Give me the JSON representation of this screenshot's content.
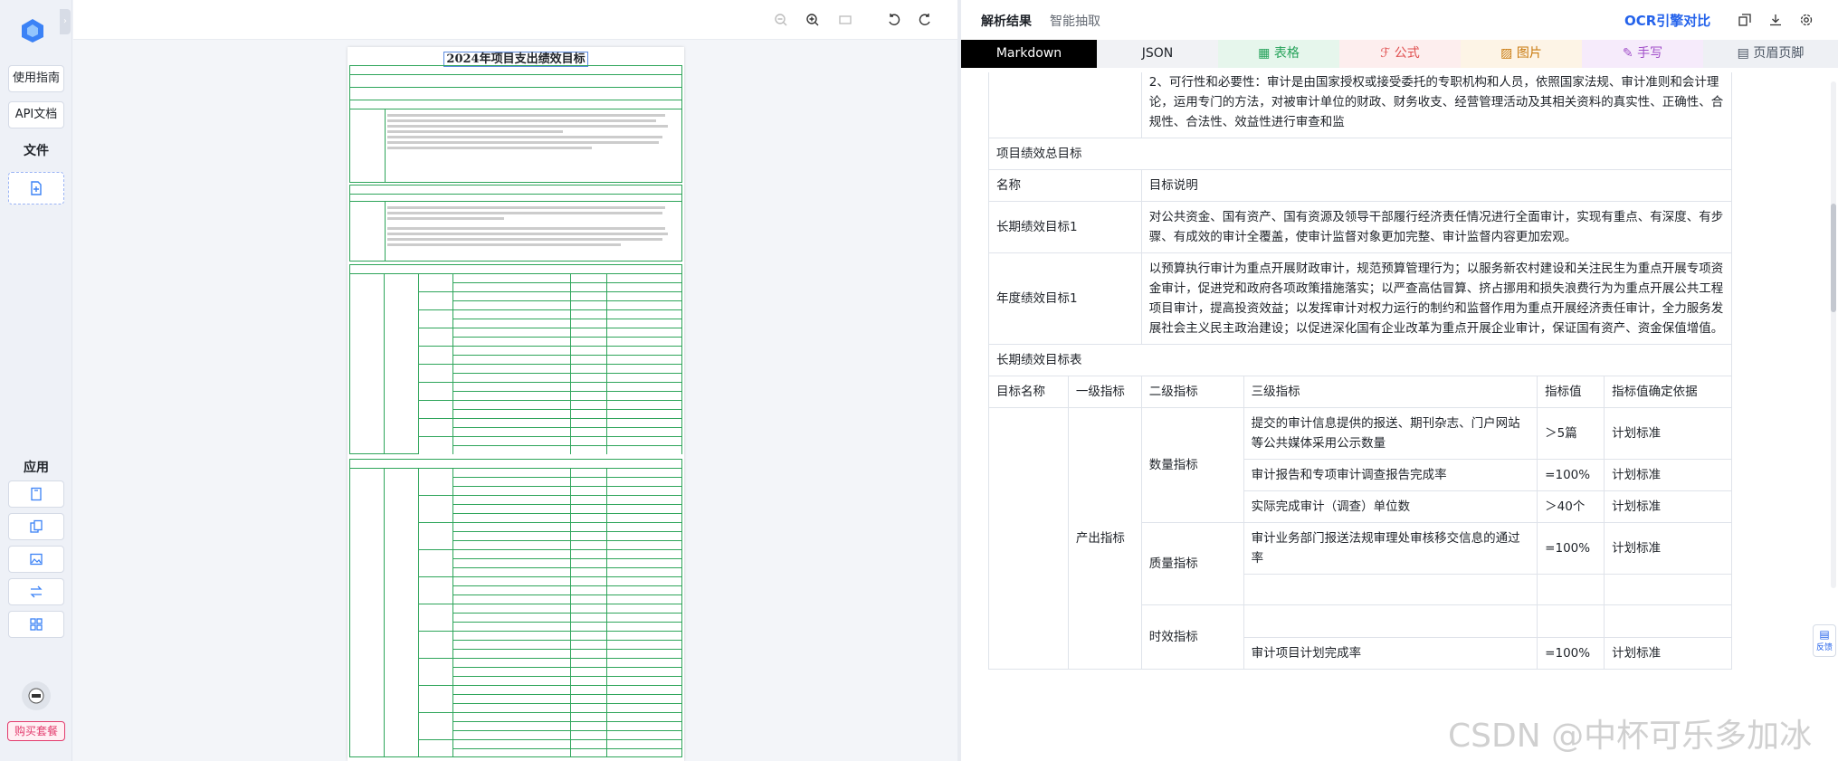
{
  "sidebar": {
    "guide_label": "使用指南",
    "api_label": "API文档",
    "files_title": "文件",
    "apps_title": "应用",
    "buy_label": "购买套餐"
  },
  "document": {
    "title": "2024年项目支出绩效目标"
  },
  "panel": {
    "tab_parse": "解析结果",
    "tab_extract": "智能抽取",
    "ocr_compare": "OCR引擎对比",
    "format_tabs": [
      {
        "label": "Markdown",
        "icon": ""
      },
      {
        "label": "JSON",
        "icon": ""
      },
      {
        "label": "表格",
        "icon": "table-icon"
      },
      {
        "label": "公式",
        "icon": "formula-icon"
      },
      {
        "label": "图片",
        "icon": "image-icon"
      },
      {
        "label": "手写",
        "icon": "handwriting-icon"
      },
      {
        "label": "页眉页脚",
        "icon": "header-footer-icon"
      }
    ],
    "feedback_label": "反馈"
  },
  "result": {
    "necessity_text": "2、可行性和必要性：审计是由国家授权或接受委托的专职机构和人员，依照国家法规、审计准则和会计理论，运用专门的方法，对被审计单位的财政、财务收支、经营管理活动及其相关资料的真实性、正确性、合规性、合法性、效益性进行审查和监",
    "overall_goal": "项目绩效总目标",
    "name_header": "名称",
    "desc_header": "目标说明",
    "long_goal_label": "长期绩效目标1",
    "long_goal_text": "对公共资金、国有资产、国有资源及领导干部履行经济责任情况进行全面审计，实现有重点、有深度、有步骤、有成效的审计全覆盖，使审计监督对象更加完整、审计监督内容更加宏观。",
    "year_goal_label": "年度绩效目标1",
    "year_goal_text": "以预算执行审计为重点开展财政审计，规范预算管理行为；以服务新农村建设和关注民生为重点开展专项资金审计，促进党和政府各项政策措施落实；以严查高估冒算、挤占挪用和损失浪费行为为重点开展公共工程项目审计，提高投资效益；以发挥审计对权力运行的制约和监督作用为重点开展经济责任审计，全力服务发展社会主义民主政治建设；以促进深化国有企业改革为重点开展企业审计，保证国有资产、资金保值增值。",
    "long_table_title": "长期绩效目标表",
    "columns": [
      "目标名称",
      "一级指标",
      "二级指标",
      "三级指标",
      "指标值",
      "指标值确定依据"
    ],
    "level1_output": "产出指标",
    "level2_quantity": "数量指标",
    "level2_quality": "质量指标",
    "level2_time": "时效指标",
    "rows": [
      {
        "l3": "提交的审计信息提供的报送、期刊杂志、门户网站等公共媒体采用公示数量",
        "value": "＞5篇",
        "basis": "计划标准"
      },
      {
        "l3": "审计报告和专项审计调查报告完成率",
        "value": "=100%",
        "basis": "计划标准"
      },
      {
        "l3": "实际完成审计（调查）单位数",
        "value": "＞40个",
        "basis": "计划标准"
      },
      {
        "l3": "审计业务部门报送法规审理处审核移交信息的通过率",
        "value": "=100%",
        "basis": "计划标准"
      },
      {
        "l3": "",
        "value": "",
        "basis": ""
      },
      {
        "l3": "",
        "value": "",
        "basis": ""
      },
      {
        "l3": "审计项目计划完成率",
        "value": "=100%",
        "basis": "计划标准"
      }
    ]
  },
  "watermark": "CSDN @中杯可乐多加冰"
}
